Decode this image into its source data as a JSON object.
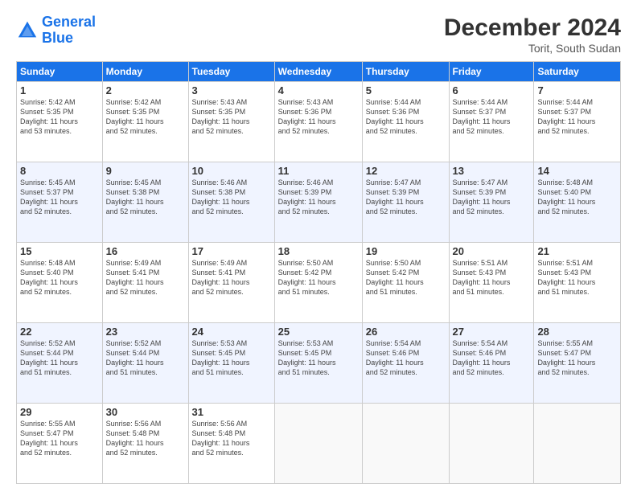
{
  "header": {
    "logo_line1": "General",
    "logo_line2": "Blue",
    "month": "December 2024",
    "location": "Torit, South Sudan"
  },
  "days_of_week": [
    "Sunday",
    "Monday",
    "Tuesday",
    "Wednesday",
    "Thursday",
    "Friday",
    "Saturday"
  ],
  "weeks": [
    [
      {
        "day": "1",
        "info": "Sunrise: 5:42 AM\nSunset: 5:35 PM\nDaylight: 11 hours\nand 53 minutes."
      },
      {
        "day": "2",
        "info": "Sunrise: 5:42 AM\nSunset: 5:35 PM\nDaylight: 11 hours\nand 52 minutes."
      },
      {
        "day": "3",
        "info": "Sunrise: 5:43 AM\nSunset: 5:35 PM\nDaylight: 11 hours\nand 52 minutes."
      },
      {
        "day": "4",
        "info": "Sunrise: 5:43 AM\nSunset: 5:36 PM\nDaylight: 11 hours\nand 52 minutes."
      },
      {
        "day": "5",
        "info": "Sunrise: 5:44 AM\nSunset: 5:36 PM\nDaylight: 11 hours\nand 52 minutes."
      },
      {
        "day": "6",
        "info": "Sunrise: 5:44 AM\nSunset: 5:37 PM\nDaylight: 11 hours\nand 52 minutes."
      },
      {
        "day": "7",
        "info": "Sunrise: 5:44 AM\nSunset: 5:37 PM\nDaylight: 11 hours\nand 52 minutes."
      }
    ],
    [
      {
        "day": "8",
        "info": "Sunrise: 5:45 AM\nSunset: 5:37 PM\nDaylight: 11 hours\nand 52 minutes."
      },
      {
        "day": "9",
        "info": "Sunrise: 5:45 AM\nSunset: 5:38 PM\nDaylight: 11 hours\nand 52 minutes."
      },
      {
        "day": "10",
        "info": "Sunrise: 5:46 AM\nSunset: 5:38 PM\nDaylight: 11 hours\nand 52 minutes."
      },
      {
        "day": "11",
        "info": "Sunrise: 5:46 AM\nSunset: 5:39 PM\nDaylight: 11 hours\nand 52 minutes."
      },
      {
        "day": "12",
        "info": "Sunrise: 5:47 AM\nSunset: 5:39 PM\nDaylight: 11 hours\nand 52 minutes."
      },
      {
        "day": "13",
        "info": "Sunrise: 5:47 AM\nSunset: 5:39 PM\nDaylight: 11 hours\nand 52 minutes."
      },
      {
        "day": "14",
        "info": "Sunrise: 5:48 AM\nSunset: 5:40 PM\nDaylight: 11 hours\nand 52 minutes."
      }
    ],
    [
      {
        "day": "15",
        "info": "Sunrise: 5:48 AM\nSunset: 5:40 PM\nDaylight: 11 hours\nand 52 minutes."
      },
      {
        "day": "16",
        "info": "Sunrise: 5:49 AM\nSunset: 5:41 PM\nDaylight: 11 hours\nand 52 minutes."
      },
      {
        "day": "17",
        "info": "Sunrise: 5:49 AM\nSunset: 5:41 PM\nDaylight: 11 hours\nand 52 minutes."
      },
      {
        "day": "18",
        "info": "Sunrise: 5:50 AM\nSunset: 5:42 PM\nDaylight: 11 hours\nand 51 minutes."
      },
      {
        "day": "19",
        "info": "Sunrise: 5:50 AM\nSunset: 5:42 PM\nDaylight: 11 hours\nand 51 minutes."
      },
      {
        "day": "20",
        "info": "Sunrise: 5:51 AM\nSunset: 5:43 PM\nDaylight: 11 hours\nand 51 minutes."
      },
      {
        "day": "21",
        "info": "Sunrise: 5:51 AM\nSunset: 5:43 PM\nDaylight: 11 hours\nand 51 minutes."
      }
    ],
    [
      {
        "day": "22",
        "info": "Sunrise: 5:52 AM\nSunset: 5:44 PM\nDaylight: 11 hours\nand 51 minutes."
      },
      {
        "day": "23",
        "info": "Sunrise: 5:52 AM\nSunset: 5:44 PM\nDaylight: 11 hours\nand 51 minutes."
      },
      {
        "day": "24",
        "info": "Sunrise: 5:53 AM\nSunset: 5:45 PM\nDaylight: 11 hours\nand 51 minutes."
      },
      {
        "day": "25",
        "info": "Sunrise: 5:53 AM\nSunset: 5:45 PM\nDaylight: 11 hours\nand 51 minutes."
      },
      {
        "day": "26",
        "info": "Sunrise: 5:54 AM\nSunset: 5:46 PM\nDaylight: 11 hours\nand 52 minutes."
      },
      {
        "day": "27",
        "info": "Sunrise: 5:54 AM\nSunset: 5:46 PM\nDaylight: 11 hours\nand 52 minutes."
      },
      {
        "day": "28",
        "info": "Sunrise: 5:55 AM\nSunset: 5:47 PM\nDaylight: 11 hours\nand 52 minutes."
      }
    ],
    [
      {
        "day": "29",
        "info": "Sunrise: 5:55 AM\nSunset: 5:47 PM\nDaylight: 11 hours\nand 52 minutes."
      },
      {
        "day": "30",
        "info": "Sunrise: 5:56 AM\nSunset: 5:48 PM\nDaylight: 11 hours\nand 52 minutes."
      },
      {
        "day": "31",
        "info": "Sunrise: 5:56 AM\nSunset: 5:48 PM\nDaylight: 11 hours\nand 52 minutes."
      },
      {
        "day": "",
        "info": ""
      },
      {
        "day": "",
        "info": ""
      },
      {
        "day": "",
        "info": ""
      },
      {
        "day": "",
        "info": ""
      }
    ]
  ]
}
